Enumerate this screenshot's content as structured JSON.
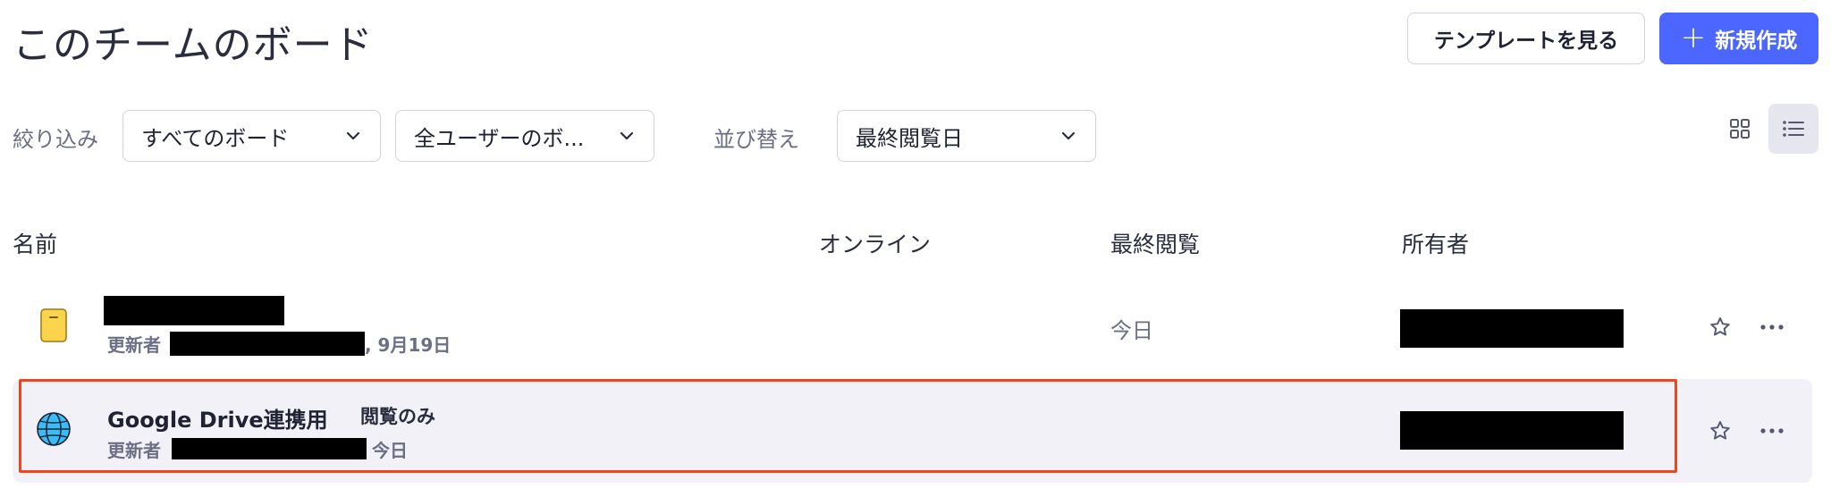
{
  "header": {
    "title": "このチームのボード",
    "template_button": "テンプレートを見る",
    "new_button": "新規作成",
    "new_button_icon": "plus-icon"
  },
  "filters": {
    "filter_label": "絞り込み",
    "board_filter_value": "すべてのボード",
    "owner_filter_value": "全ユーザーのボ...",
    "sort_label": "並び替え",
    "sort_value": "最終閲覧日"
  },
  "view_toggle": {
    "grid_icon": "grid-view-icon",
    "list_icon": "list-view-icon",
    "active": "list"
  },
  "table": {
    "columns": [
      "名前",
      "オンライン",
      "最終閲覧",
      "所有者"
    ],
    "rows": [
      {
        "icon": "yellow-board-icon",
        "title": "",
        "updated_by_label": "更新者",
        "updated_date": ", 9月19日",
        "read_only_badge": "",
        "last_viewed": "今日",
        "star_icon": "star-icon",
        "more_icon": "more-horizontal-icon"
      },
      {
        "icon": "globe-icon",
        "title": "Google Drive連携用",
        "updated_by_label": "更新者",
        "updated_date": "今日",
        "read_only_badge": "閲覧のみ",
        "last_viewed": "",
        "star_icon": "star-icon",
        "more_icon": "more-horizontal-icon"
      }
    ]
  },
  "colors": {
    "accent": "#4b67ff",
    "highlight_border": "#f0451a",
    "selected_row_bg": "#f1f1f7"
  }
}
